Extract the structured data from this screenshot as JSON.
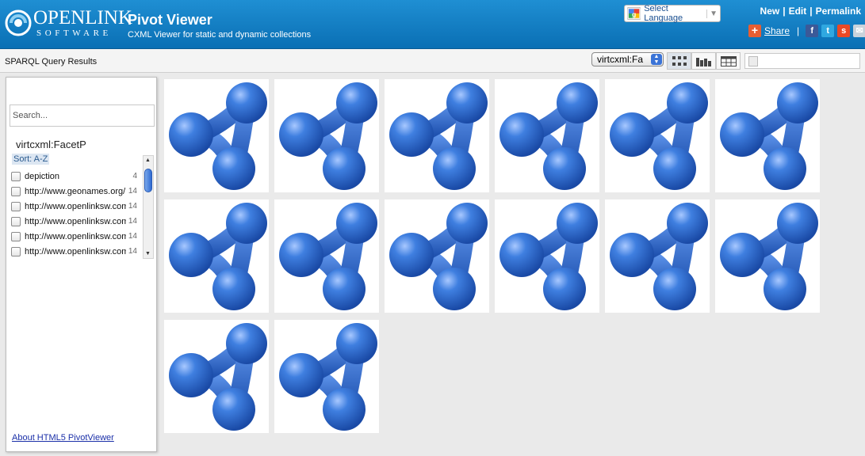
{
  "header": {
    "logo_word": "OPENLINK",
    "logo_sub": "SOFTWARE",
    "title": "Pivot Viewer",
    "subtitle": "CXML Viewer for static and dynamic collections",
    "language_select": "Select Language",
    "links": [
      "New",
      "Edit",
      "Permalink"
    ],
    "share_label": "Share",
    "share_icons": [
      "addthis-plus-icon",
      "facebook-icon",
      "twitter-icon",
      "stumbleupon-icon",
      "email-icon"
    ]
  },
  "toolbar": {
    "title": "SPARQL Query Results",
    "facet_select_value": "virtcxml:Fa",
    "view_buttons": [
      "grid-view-icon",
      "histogram-view-icon",
      "table-view-icon"
    ]
  },
  "sidebar": {
    "search_placeholder": "Search...",
    "facet_title": "virtcxml:FacetP",
    "sort_label": "Sort: A-Z",
    "items": [
      {
        "label": "depiction",
        "count": "4"
      },
      {
        "label": "http://www.geonames.org/",
        "count": "14"
      },
      {
        "label": "http://www.openlinksw.com",
        "count": "14"
      },
      {
        "label": "http://www.openlinksw.com",
        "count": "14"
      },
      {
        "label": "http://www.openlinksw.com",
        "count": "14"
      },
      {
        "label": "http://www.openlinksw.com",
        "count": "14"
      }
    ],
    "about_link": "About HTML5 PivotViewer"
  },
  "grid": {
    "tile_count": 14,
    "columns": 6,
    "tile_image": "rdf-molecule-icon"
  },
  "colors": {
    "header_top": "#1f8fd3",
    "header_bottom": "#0a6fb4",
    "molecule_blue": "#2f6fd0"
  }
}
